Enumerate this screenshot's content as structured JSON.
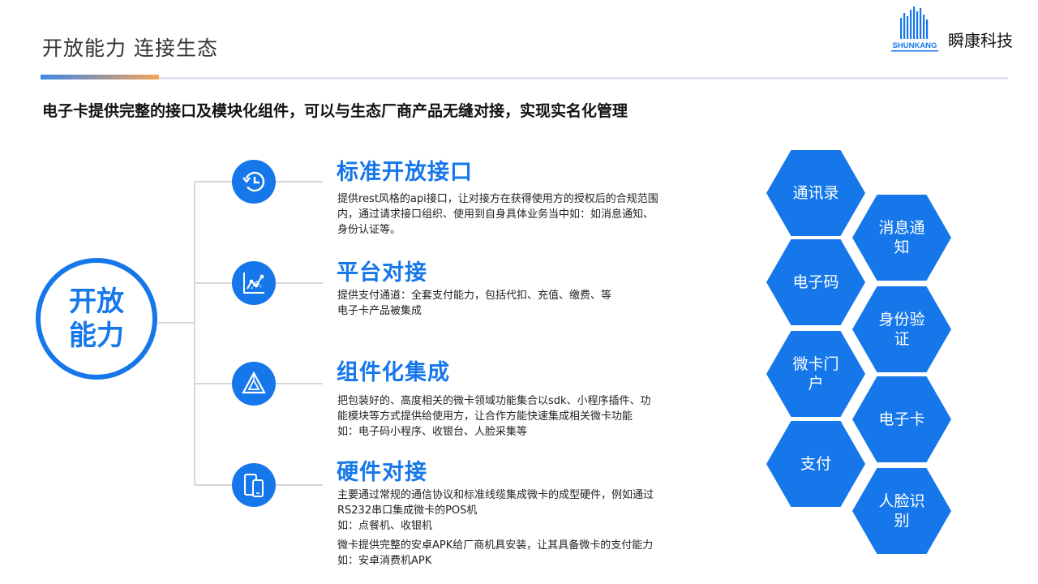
{
  "header": {
    "title": "开放能力 连接生态",
    "logo_text": "瞬康科技",
    "logo_mark_text": "SHUNKANG"
  },
  "subtitle": "电子卡提供完整的接口及模块化组件，可以与生态厂商产品无缝对接，实现实名化管理",
  "center": {
    "line1": "开放",
    "line2": "能力"
  },
  "colors": {
    "accent": "#1677ea",
    "gradient_start": "#3f86e8",
    "gradient_end": "#f2a65a",
    "rule": "#dfe4ec"
  },
  "sections": [
    {
      "icon": "history-clock-icon",
      "title": "标准开放接口",
      "lines": [
        "提供rest风格的api接口，让对接方在获得使用方的授权后的合规范围",
        "内，通过请求接口组织、使用到自身具体业务当中如：如消息通知、",
        "身份认证等。"
      ]
    },
    {
      "icon": "line-chart-icon",
      "title": "平台对接",
      "lines": [
        "提供支付通道：全套支付能力，包括代扣、充值、缴费、等",
        "电子卡产品被集成"
      ]
    },
    {
      "icon": "triangle-components-icon",
      "title": "组件化集成",
      "lines": [
        "把包装好的、高度相关的微卡领域功能集合以sdk、小程序插件、功",
        "能模块等方式提供给使用方，让合作方能快速集成相关微卡功能",
        "如：电子码小程序、收银台、人脸采集等"
      ]
    },
    {
      "icon": "mobile-devices-icon",
      "title": "硬件对接",
      "lines": [
        "主要通过常规的通信协议和标准线缆集成微卡的成型硬件，例如通过",
        "RS232串口集成微卡的POS机",
        "如：点餐机、收银机"
      ],
      "lines2": [
        "微卡提供完整的安卓APK给厂商机具安装，让其具备微卡的支付能力",
        "如：安卓消费机APK"
      ]
    }
  ],
  "hexes": [
    {
      "label": "通讯录"
    },
    {
      "label": "消息通知"
    },
    {
      "label": "电子码"
    },
    {
      "label": "身份验证"
    },
    {
      "label": "微卡门户"
    },
    {
      "label": "电子卡"
    },
    {
      "label": "支付"
    },
    {
      "label": "人脸识别"
    }
  ]
}
